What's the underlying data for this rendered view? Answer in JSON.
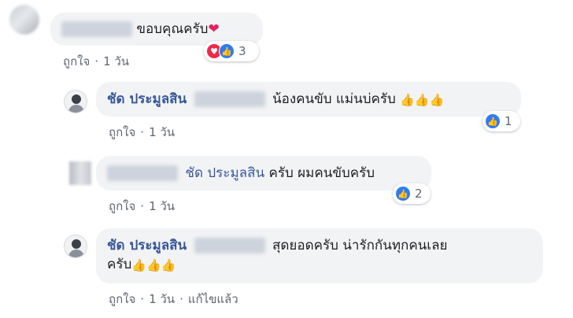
{
  "comments": [
    {
      "text": "ขอบคุณครับ",
      "emoji": "❤",
      "meta_like": "ถูกใจ",
      "meta_time": "1 วัน",
      "reaction_count": "3",
      "reaction_icons": [
        "heart-icon",
        "like-icon"
      ]
    },
    {
      "author": "ชัด ประมูลสิน",
      "text": "น้องคนขับ แม่นบ่ครับ",
      "emoji": "👍👍👍",
      "meta_like": "ถูกใจ",
      "meta_time": "1 วัน",
      "reaction_count": "1",
      "reaction_icons": [
        "like-icon"
      ]
    },
    {
      "mention": "ชัด ประมูลสิน",
      "text": "ครับ ผมคนขับครับ",
      "meta_like": "ถูกใจ",
      "meta_time": "1 วัน",
      "reaction_count": "2",
      "reaction_icons": [
        "like-icon"
      ]
    },
    {
      "author": "ชัด ประมูลสิน",
      "text_line1": "สุดยอดครับ น่ารักกันทุกคนเลย",
      "text_line2": "ครับ",
      "emoji": "👍👍👍",
      "meta_like": "ถูกใจ",
      "meta_time": "1 วัน",
      "meta_edited": "แก้ไขแล้ว"
    }
  ],
  "colors": {
    "link": "#385898",
    "bubble": "#f2f3f5",
    "meta": "#606770",
    "like": "#2e7cf6",
    "love": "#f0284a"
  }
}
